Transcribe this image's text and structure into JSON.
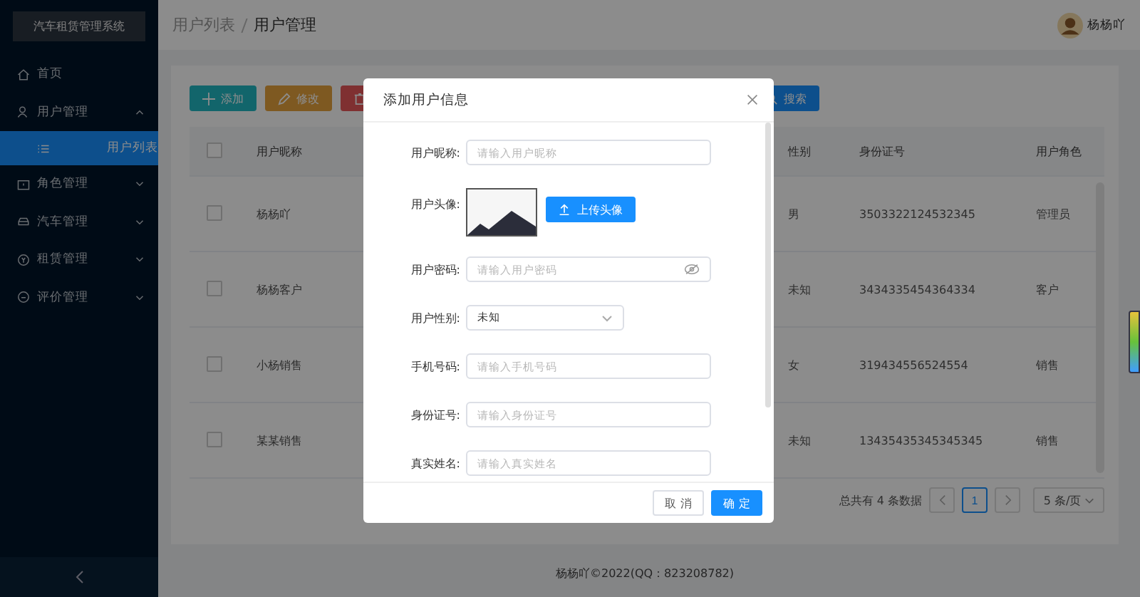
{
  "sidebar": {
    "title": "汽车租赁管理系统",
    "items": [
      {
        "label": "首页",
        "selected": false
      },
      {
        "label": "用户管理",
        "selected": false,
        "expanded": true,
        "children": [
          {
            "label": "用户列表",
            "selected": true
          }
        ]
      },
      {
        "label": "角色管理",
        "selected": false,
        "expanded": false
      },
      {
        "label": "汽车管理",
        "selected": false,
        "expanded": false
      },
      {
        "label": "租赁管理",
        "selected": false,
        "expanded": false
      },
      {
        "label": "评价管理",
        "selected": false,
        "expanded": false
      }
    ]
  },
  "header": {
    "breadcrumb": [
      "用户列表",
      "用户管理"
    ],
    "user_name": "杨杨吖"
  },
  "toolbar": {
    "buttons": [
      {
        "kind": "add",
        "label": "添加"
      },
      {
        "kind": "edit",
        "label": "修改"
      },
      {
        "kind": "delete"
      }
    ],
    "search_label": "搜索"
  },
  "table": {
    "all_checked": false,
    "columns": [
      "用户昵称",
      "性别",
      "身份证号",
      "用户角色"
    ],
    "rows": [
      {
        "checked": false,
        "cells": [
          "杨杨吖",
          "男",
          "3503322124532345",
          "管理员"
        ]
      },
      {
        "checked": false,
        "cells": [
          "杨杨客户",
          "未知",
          "3434335454364334",
          "客户"
        ]
      },
      {
        "checked": false,
        "cells": [
          "小杨销售",
          "女",
          "319434556524554",
          "销售"
        ]
      },
      {
        "checked": false,
        "cells": [
          "某某销售",
          "未知",
          "13435435345345345",
          "销售"
        ]
      }
    ]
  },
  "pagination": {
    "total": "总共有 4 条数据",
    "pages": [
      {
        "label": "1",
        "selected": true
      }
    ],
    "page_size": "5 条/页"
  },
  "footer": "杨杨吖©2022(QQ：823208782)",
  "dialog": {
    "title": "添加用户信息",
    "fields": [
      {
        "kind": "text",
        "label": "用户昵称:",
        "placeholder": "请输入用户昵称"
      },
      {
        "kind": "avatar",
        "label": "用户头像:",
        "button": "上传头像"
      },
      {
        "kind": "password",
        "label": "用户密码:",
        "placeholder": "请输入用户密码"
      },
      {
        "kind": "select",
        "label": "用户性别:",
        "value": "未知"
      },
      {
        "kind": "text",
        "label": "手机号码:",
        "placeholder": "请输入手机号码"
      },
      {
        "kind": "text",
        "label": "身份证号:",
        "placeholder": "请输入身份证号"
      },
      {
        "kind": "text",
        "label": "真实姓名:",
        "placeholder": "请输入真实姓名"
      }
    ],
    "cancel": "取 消",
    "confirm": "确 定"
  }
}
